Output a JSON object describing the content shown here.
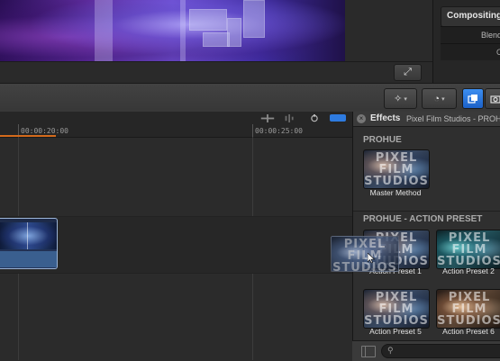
{
  "viewer": {
    "fullscreen_icon": "expand-arrows-icon",
    "fullscreen_glyph": "⤢"
  },
  "inspector": {
    "section_title": "Compositing",
    "blend_label": "Blend",
    "opacity_label": "O"
  },
  "toolbar": {
    "magic_wand_icon": "magic-wand-icon",
    "magic_wand_glyph": "✧",
    "retime_icon": "retime-speedometer-icon",
    "retime_glyph": "◔",
    "caret_glyph": "▾",
    "accent_color": "#2e7be0"
  },
  "timeline": {
    "timecodes": [
      "00:00:20:00",
      "00:00:25:00"
    ],
    "playhead_color": "#d46a1c",
    "clip_color": "#3a5f8f"
  },
  "effects": {
    "close_glyph": "×",
    "title": "Effects",
    "path": "Pixel Film Studios - PROHUE",
    "sections": [
      {
        "label": "PROHUE"
      },
      {
        "label": "PROHUE - ACTION PRESET"
      }
    ],
    "items": [
      {
        "label": "Master Method",
        "logo": "PIXEL FILM STUDIOS"
      },
      {
        "label": "Action Preset 1",
        "logo": "PIXEL FILM STUDIOS"
      },
      {
        "label": "Action Preset 2",
        "logo": "PIXEL FILM STUDIOS"
      },
      {
        "label": "Action Preset 5",
        "logo": "PIXEL FILM STUDIOS"
      },
      {
        "label": "Action Preset 6",
        "logo": "PIXEL FILM STUDIOS"
      }
    ],
    "search_icon_glyph": "⚲"
  }
}
